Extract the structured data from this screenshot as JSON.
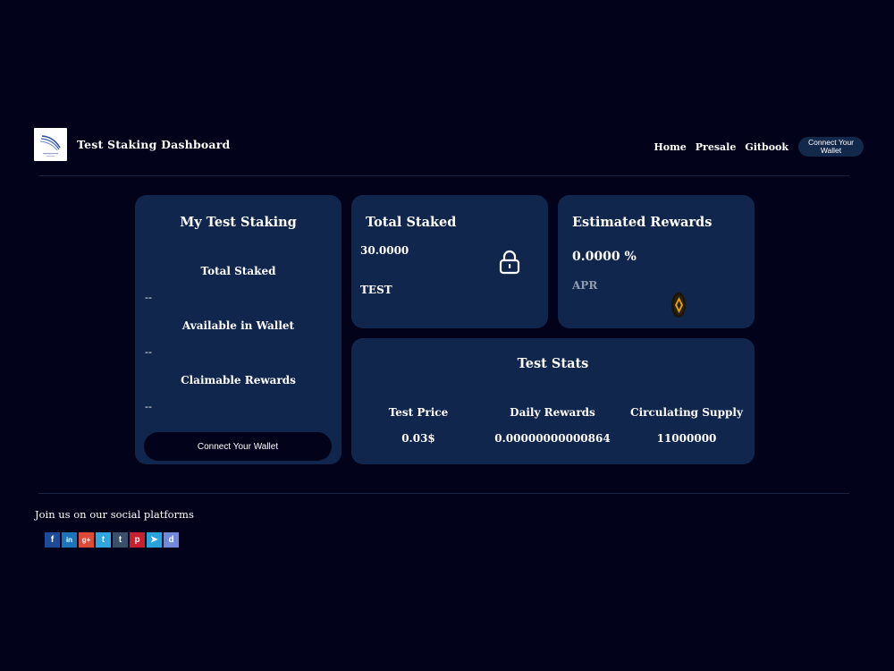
{
  "header": {
    "logo_icon": "blue-swoosh-logo-icon",
    "title": "Test Staking Dashboard",
    "nav": [
      {
        "label": "Home"
      },
      {
        "label": "Presale"
      },
      {
        "label": "Gitbook"
      }
    ],
    "connect_wallet_label": "Connect Your Wallet"
  },
  "my_staking": {
    "title": "My Test Staking",
    "total_staked_label": "Total Staked",
    "total_staked_value": "--",
    "available_label": "Available in Wallet",
    "available_value": "--",
    "claimable_label": "Claimable Rewards",
    "claimable_value": "--",
    "connect_wallet_label": "Connect Your Wallet"
  },
  "total_staked": {
    "title": "Total Staked",
    "amount": "30.0000",
    "token": "TEST",
    "icon": "lock-icon"
  },
  "rewards": {
    "title": "Estimated Rewards",
    "percent": "0.0000 %",
    "apr_label": "APR",
    "icon": "coin-icon"
  },
  "stats": {
    "title": "Test Stats",
    "items": [
      {
        "label": "Test Price",
        "value": "0.03$"
      },
      {
        "label": "Daily Rewards",
        "value": "0.00000000000864"
      },
      {
        "label": "Circulating Supply",
        "value": "11000000"
      }
    ]
  },
  "footer": {
    "social_text": "Join us on our social platforms",
    "socials": [
      {
        "name": "facebook-icon",
        "glyph": "f",
        "color": "#1d4b9a"
      },
      {
        "name": "linkedin-icon",
        "glyph": "in",
        "color": "#1b75b8"
      },
      {
        "name": "google-plus-icon",
        "glyph": "g+",
        "color": "#dc4a38"
      },
      {
        "name": "twitter-icon",
        "glyph": "t",
        "color": "#2fa6e0"
      },
      {
        "name": "tumblr-icon",
        "glyph": "t",
        "color": "#3a4f6a"
      },
      {
        "name": "pinterest-icon",
        "glyph": "p",
        "color": "#c8202f"
      },
      {
        "name": "telegram-icon",
        "glyph": "➤",
        "color": "#2aa3dd"
      },
      {
        "name": "discord-icon",
        "glyph": "d",
        "color": "#7289da"
      }
    ]
  },
  "colors": {
    "background": "#02031a",
    "card": "#10264c",
    "nav_button": "#13294b",
    "muted_text": "#8f9bb0",
    "coin_gold": "#e0a21a"
  }
}
